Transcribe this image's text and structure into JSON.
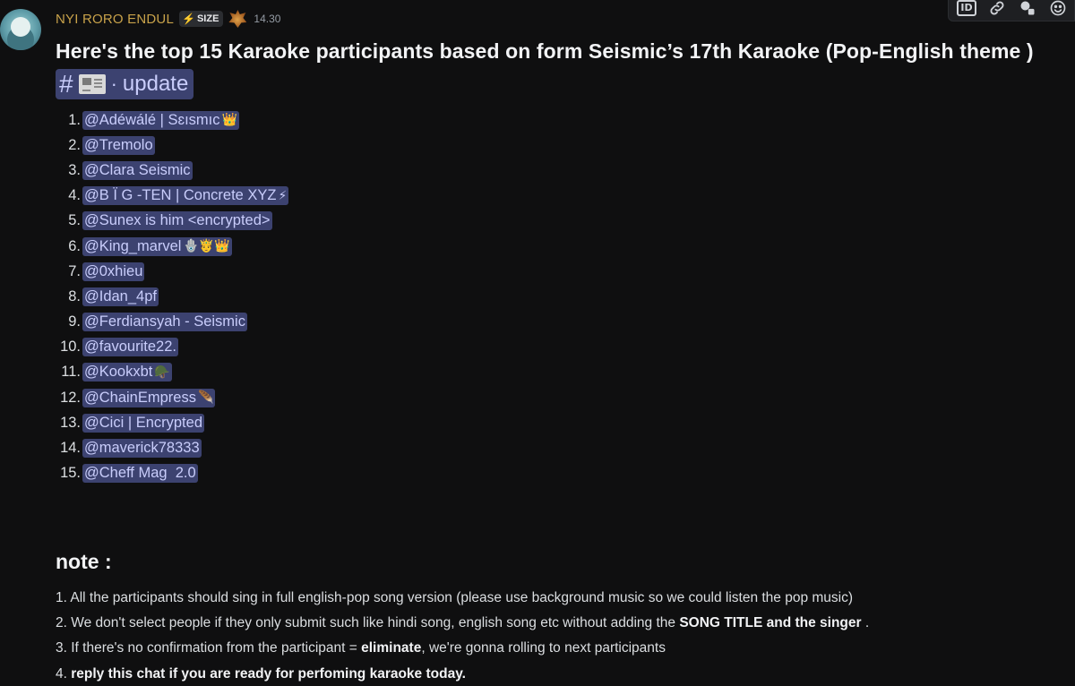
{
  "header": {
    "username": "NYI RORO ENDUL",
    "tag_icon": "⚡",
    "tag_label": "SIZE",
    "timestamp": "14.30"
  },
  "message": {
    "title": "Here's the top 15 Karaoke participants based on form Seismic’s 17th Karaoke (Pop-English theme )",
    "channel": {
      "hash": "#",
      "label": "update",
      "separator": "·"
    },
    "participants": [
      {
        "rank": "1.",
        "name": "@Adéwálé | Sɛısmıc",
        "emoji": "👑"
      },
      {
        "rank": "2.",
        "name": "@Tremolo",
        "emoji": ""
      },
      {
        "rank": "3.",
        "name": "@Clara Seismic",
        "emoji": ""
      },
      {
        "rank": "4.",
        "name": "@B Ï G -TEN | Concrete XYZ",
        "emoji": "⚡"
      },
      {
        "rank": "5.",
        "name": "@Sunex is him <encrypted>",
        "emoji": ""
      },
      {
        "rank": "6.",
        "name": "@King_marvel",
        "emoji": "🪬🤴👑"
      },
      {
        "rank": "7.",
        "name": "@0xhieu",
        "emoji": ""
      },
      {
        "rank": "8.",
        "name": "@Idan_4pf",
        "emoji": ""
      },
      {
        "rank": "9.",
        "name": "@Ferdiansyah - Seismic",
        "emoji": ""
      },
      {
        "rank": "10.",
        "name": "@favourite22.",
        "emoji": ""
      },
      {
        "rank": "11.",
        "name": "@Kookxbt",
        "emoji": "🪖"
      },
      {
        "rank": "12.",
        "name": "@ChainEmpress",
        "emoji": "🪶"
      },
      {
        "rank": "13.",
        "name": "@Cici | Encrypted",
        "emoji": ""
      },
      {
        "rank": "14.",
        "name": "@maverick78333",
        "emoji": ""
      },
      {
        "rank": "15.",
        "name": "@Cheff Mag  2.0",
        "emoji": ""
      }
    ],
    "note_heading": "note :",
    "notes": [
      {
        "n": "1.",
        "parts": [
          {
            "t": " All the participants should sing in full english-pop song version (please use background music so we could listen the pop music)",
            "b": false
          }
        ]
      },
      {
        "n": "2.",
        "parts": [
          {
            "t": " We don't select people if they only submit such like hindi song, english song etc without adding the ",
            "b": false
          },
          {
            "t": "SONG TITLE and the singer",
            "b": true
          },
          {
            "t": " .",
            "b": false
          }
        ]
      },
      {
        "n": "3.",
        "parts": [
          {
            "t": " If there's no confirmation from the participant = ",
            "b": false
          },
          {
            "t": "eliminate",
            "b": true
          },
          {
            "t": ", we're gonna rolling to next participants",
            "b": false
          }
        ]
      },
      {
        "n": "4.",
        "parts": [
          {
            "t": " ",
            "b": false
          },
          {
            "t": "reply this chat if you are ready for perfoming karaoke today.",
            "b": true
          }
        ]
      }
    ]
  },
  "toolbar": {
    "id_label": "ID",
    "icons": [
      "id-icon",
      "link-icon",
      "apps-icon",
      "add-reaction-icon"
    ]
  }
}
